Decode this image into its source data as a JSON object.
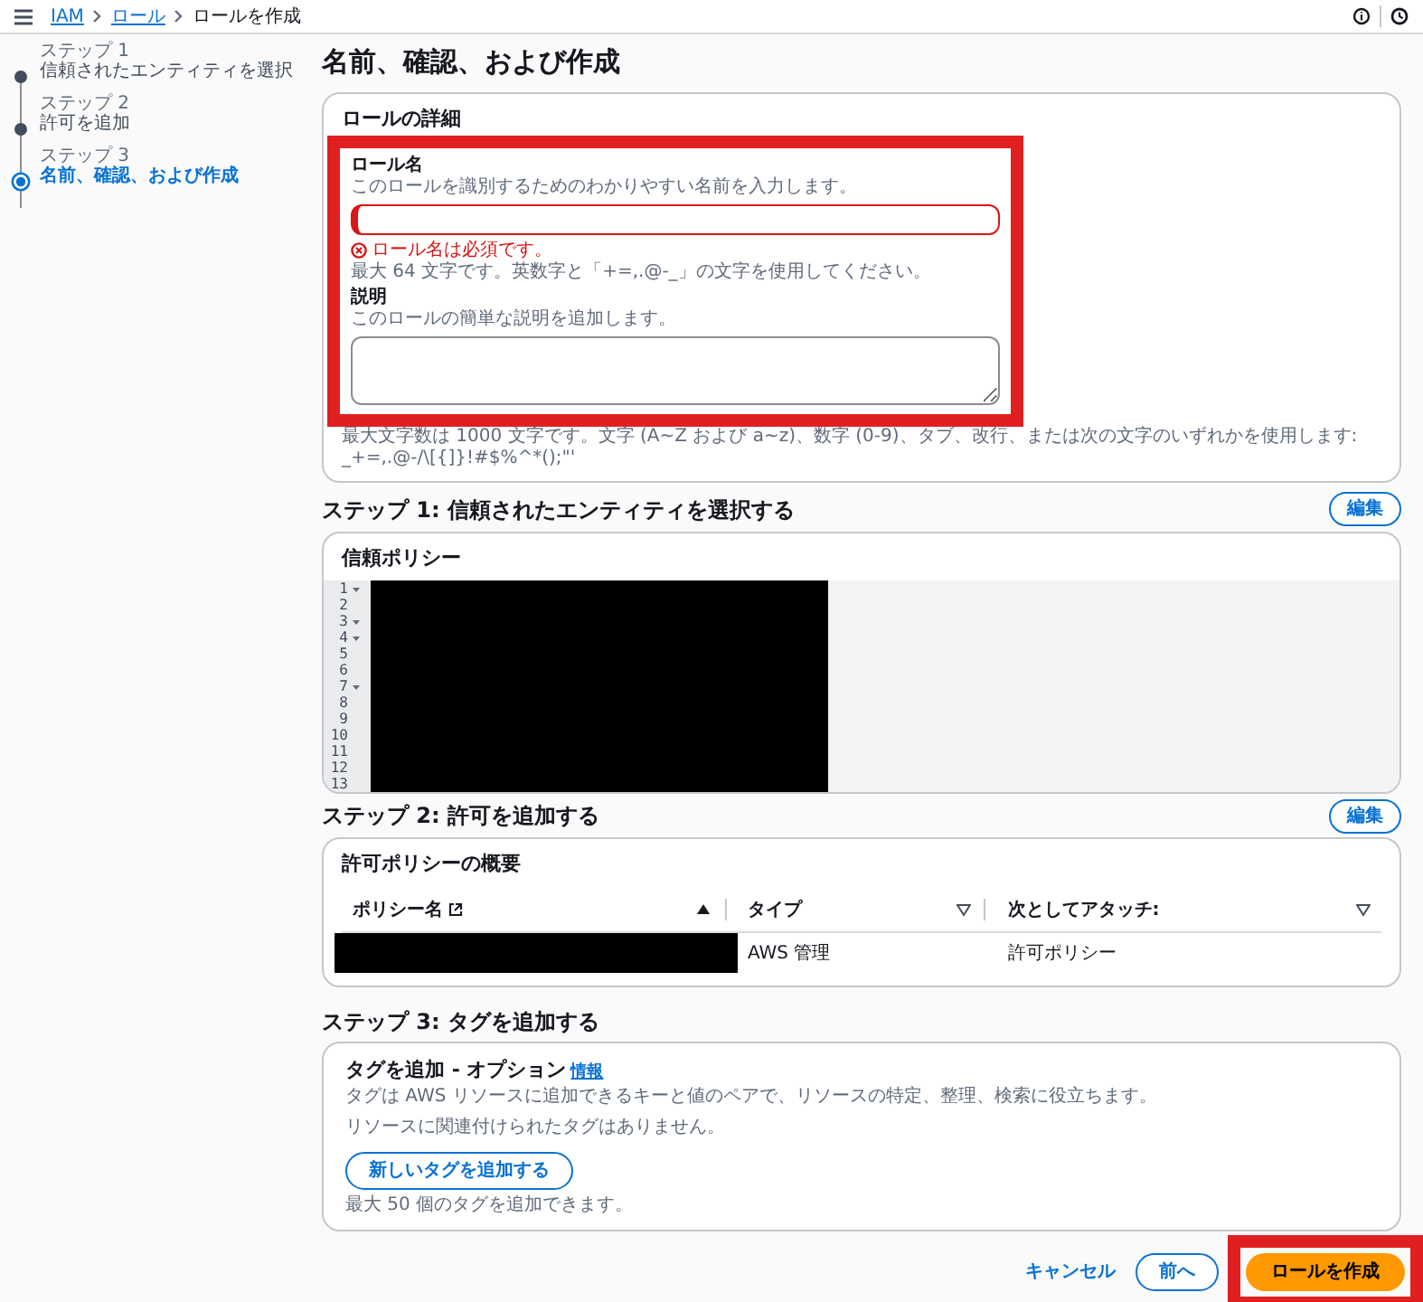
{
  "breadcrumbs": [
    {
      "label": "IAM",
      "link": true
    },
    {
      "label": "ロール",
      "link": true
    },
    {
      "label": "ロールを作成",
      "link": false
    }
  ],
  "steps": [
    {
      "step_label": "ステップ 1",
      "title": "信頼されたエンティティを選択",
      "selected": false
    },
    {
      "step_label": "ステップ 2",
      "title": "許可を追加",
      "selected": false
    },
    {
      "step_label": "ステップ 3",
      "title": "名前、確認、および作成",
      "selected": true
    }
  ],
  "page_title": "名前、確認、および作成",
  "details": {
    "title": "ロールの詳細",
    "highlighted": true,
    "name_label": "ロール名",
    "name_hint": "このロールを識別するためのわかりやすい名前を入力します。",
    "name_invalid": true,
    "error": "ロール名は必須です。",
    "name_constraint": "最大 64 文字です。英数字と「+=,.@-_」の文字を使用してください。",
    "desc_label": "説明",
    "desc_hint": "このロールの簡単な説明を追加します。",
    "desc_constraint": "最大文字数は 1000 文字です。文字 (A~Z および a~z)、数字 (0-9)、タブ、改行、または次の文字のいずれかを使用します: _+=,.@-/\\[{]}!#$%^*();\"'"
  },
  "step1": {
    "title": "ステップ 1: 信頼されたエンティティを選択する",
    "edit_button": "編集",
    "card_title": "信頼ポリシー",
    "lines": [
      {
        "number": "1",
        "foldable": true
      },
      {
        "number": "2",
        "foldable": false
      },
      {
        "number": "3",
        "foldable": true
      },
      {
        "number": "4",
        "foldable": true
      },
      {
        "number": "5",
        "foldable": false
      },
      {
        "number": "6",
        "foldable": false
      },
      {
        "number": "7",
        "foldable": true
      },
      {
        "number": "8",
        "foldable": false
      },
      {
        "number": "9",
        "foldable": false
      },
      {
        "number": "10",
        "foldable": false
      },
      {
        "number": "11",
        "foldable": false
      },
      {
        "number": "12",
        "foldable": false
      },
      {
        "number": "13",
        "foldable": false
      }
    ]
  },
  "step2": {
    "title": "ステップ 2: 許可を追加する",
    "edit_button": "編集",
    "card_title": "許可ポリシーの概要",
    "columns": [
      {
        "label": "ポリシー名",
        "external": true,
        "sorted": true
      },
      {
        "label": "タイプ",
        "external": false,
        "sorted": false
      },
      {
        "label": "次としてアタッチ:",
        "external": false,
        "sorted": false
      }
    ],
    "rows": [
      {
        "type": "AWS 管理",
        "attached_as": "許可ポリシー"
      }
    ]
  },
  "step3": {
    "title": "ステップ 3: タグを追加する",
    "card_title": "タグを追加 - オプション",
    "info_link": "情報",
    "description": "タグは AWS リソースに追加できるキーと値のペアで、リソースの特定、整理、検索に役立ちます。",
    "empty_text": "リソースに関連付けられたタグはありません。",
    "add_button": "新しいタグを追加する",
    "limit": "最大 50 個のタグを追加できます。"
  },
  "footer": {
    "cancel": "キャンセル",
    "previous": "前へ",
    "create": "ロールを作成",
    "create_highlighted": true
  }
}
